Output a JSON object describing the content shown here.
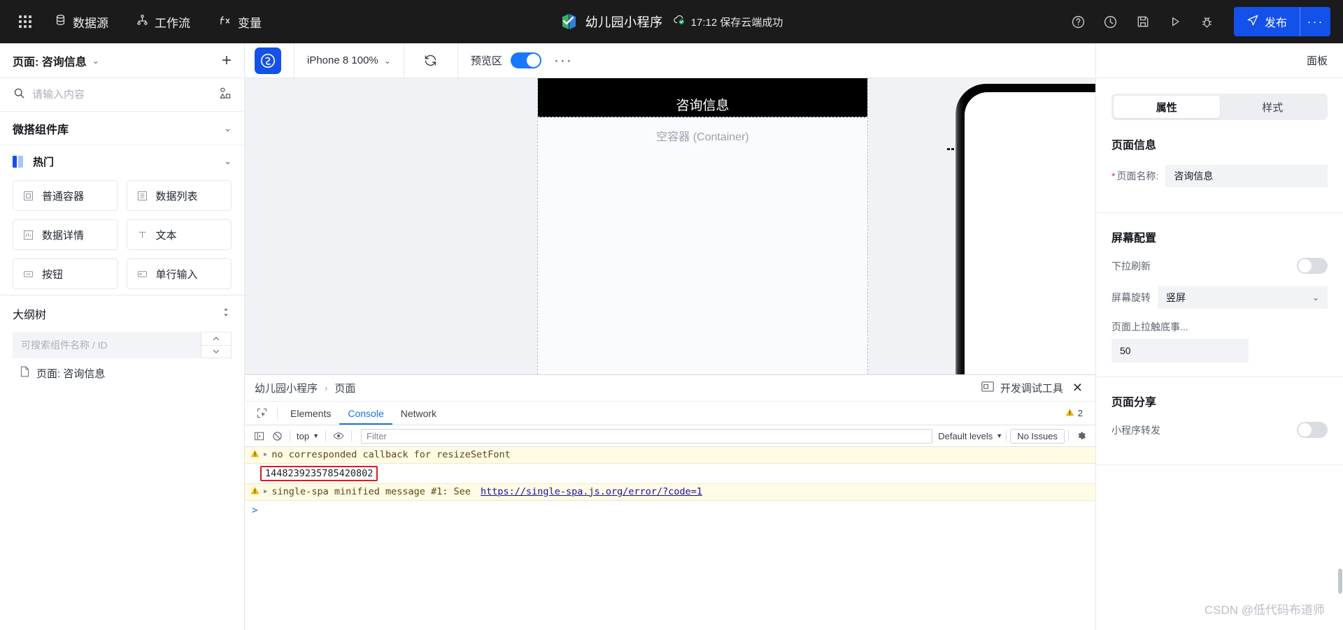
{
  "topbar": {
    "apps_icon": "grid-apps-icon",
    "menu": [
      {
        "label": "数据源",
        "icon": "database-icon"
      },
      {
        "label": "工作流",
        "icon": "workflow-icon"
      },
      {
        "label": "变量",
        "icon": "fx-icon"
      }
    ],
    "project_title": "幼儿园小程序",
    "save_status": "17:12 保存云端成功",
    "actions": [
      {
        "name": "help-icon",
        "title": "帮助"
      },
      {
        "name": "history-icon",
        "title": "历史"
      },
      {
        "name": "save-icon",
        "title": "保存"
      },
      {
        "name": "preview-run-icon",
        "title": "预览"
      },
      {
        "name": "debug-icon",
        "title": "调试"
      }
    ],
    "publish_label": "发布",
    "publish_more": "···"
  },
  "left": {
    "page_title": "页面: 咨询信息",
    "add_tooltip": "+",
    "search_placeholder": "请输入内容",
    "library_section": "微搭组件库",
    "hot_section": "热门",
    "components": [
      {
        "label": "普通容器",
        "icon": "container-icon"
      },
      {
        "label": "数据列表",
        "icon": "list-icon"
      },
      {
        "label": "数据详情",
        "icon": "detail-icon"
      },
      {
        "label": "文本",
        "icon": "text-icon"
      },
      {
        "label": "按钮",
        "icon": "button-icon"
      },
      {
        "label": "单行输入",
        "icon": "input-icon"
      }
    ],
    "outline_title": "大纲树",
    "outline_search_placeholder": "可搜索组件名称 / ID",
    "tree": [
      {
        "label": "页面: 咨询信息",
        "icon": "page-file-icon"
      }
    ]
  },
  "canvas": {
    "device_label": "iPhone 8 100%",
    "refresh_icon": "refresh-icon",
    "preview_label": "预览区",
    "preview_on": true,
    "more": "···",
    "page_header_title": "咨询信息",
    "container_placeholder": "空容器 (Container)"
  },
  "devtools": {
    "breadcrumb": [
      "幼儿园小程序",
      "页面"
    ],
    "breadcrumb_sep": "›",
    "panel_label": "开发调试工具",
    "close": "✕",
    "tabs": [
      {
        "label": "Elements",
        "active": false
      },
      {
        "label": "Console",
        "active": true
      },
      {
        "label": "Network",
        "active": false
      }
    ],
    "warning_count": "2",
    "context": "top",
    "filter_placeholder": "Filter",
    "levels_label": "Default levels",
    "issues_label": "No Issues",
    "logs": [
      {
        "type": "warning",
        "text": "no corresponded callback for resizeSetFont",
        "expandable": true
      },
      {
        "type": "value",
        "text": "1448239235785420802",
        "highlighted": true
      },
      {
        "type": "warning",
        "text": "single-spa minified message #1: See ",
        "link": "https://single-spa.js.org/error/?code=1",
        "expandable": true
      }
    ],
    "prompt": ">"
  },
  "right": {
    "panel_label": "面板",
    "tabs": [
      {
        "label": "属性",
        "active": true
      },
      {
        "label": "样式",
        "active": false
      }
    ],
    "sections": [
      {
        "title": "页面信息",
        "fields": [
          {
            "type": "input",
            "required": true,
            "label": "页面名称:",
            "value": "咨询信息"
          }
        ]
      },
      {
        "title": "屏幕配置",
        "fields": [
          {
            "type": "toggle",
            "label": "下拉刷新",
            "value": false
          },
          {
            "type": "select",
            "label": "屏幕旋转",
            "value": "竖屏"
          },
          {
            "type": "stacked-input",
            "label": "页面上拉触底事...",
            "value": "50"
          }
        ]
      },
      {
        "title": "页面分享",
        "fields": [
          {
            "type": "toggle",
            "label": "小程序转发",
            "value": false
          }
        ]
      }
    ]
  },
  "watermark": "CSDN @低代码布道师",
  "colors": {
    "accent": "#1351ea",
    "topbar_bg": "#1b1b1b",
    "devtools_tab_active": "#1a73e8",
    "warning_bg": "#fffbe5",
    "highlight_border": "#e01b1b"
  }
}
